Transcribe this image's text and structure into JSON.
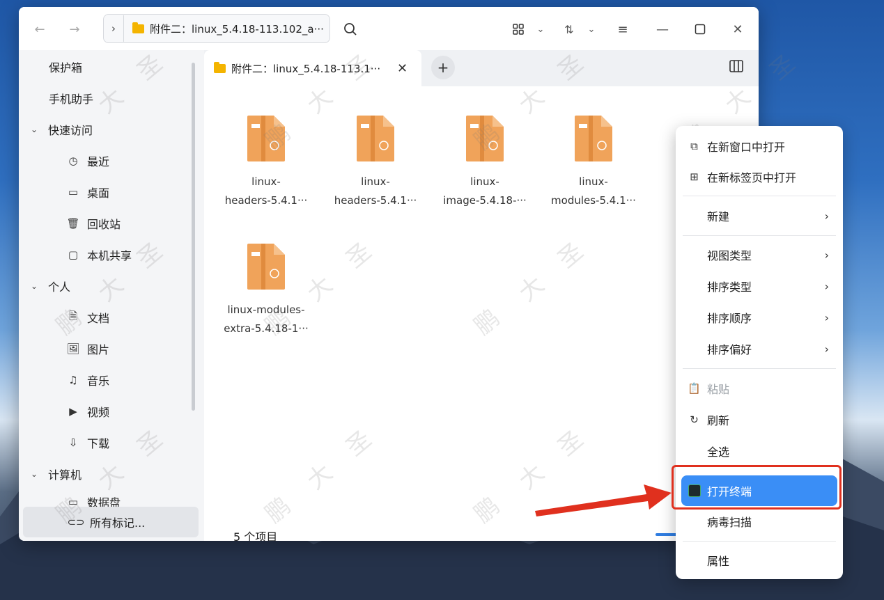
{
  "titlebar": {
    "address_text": "附件二：linux_5.4.18-113.102_a···",
    "back_icon": "arrow-left-icon",
    "forward_icon": "arrow-right-icon"
  },
  "sidebar": {
    "items": [
      {
        "label": "保护箱"
      },
      {
        "label": "手机助手"
      },
      {
        "label": "快速访问"
      },
      {
        "label": "最近"
      },
      {
        "label": "桌面"
      },
      {
        "label": "回收站"
      },
      {
        "label": "本机共享"
      },
      {
        "label": "个人"
      },
      {
        "label": "文档"
      },
      {
        "label": "图片"
      },
      {
        "label": "音乐"
      },
      {
        "label": "视频"
      },
      {
        "label": "下载"
      },
      {
        "label": "计算机"
      },
      {
        "label": "数据盘"
      }
    ],
    "tags_button": "所有标记..."
  },
  "tab": {
    "title": "附件二：linux_5.4.18-113.1···"
  },
  "files": [
    {
      "line1": "linux-",
      "line2": "headers-5.4.1···"
    },
    {
      "line1": "linux-",
      "line2": "headers-5.4.1···"
    },
    {
      "line1": "linux-",
      "line2": "image-5.4.18-···"
    },
    {
      "line1": "linux-",
      "line2": "modules-5.4.1···"
    },
    {
      "line1": "linux-modules-",
      "line2": "extra-5.4.18-1···"
    }
  ],
  "status": {
    "count_text": "5 个项目"
  },
  "context_menu": {
    "items": [
      {
        "label": "在新窗口中打开"
      },
      {
        "label": "在新标签页中打开"
      },
      {
        "label": "新建"
      },
      {
        "label": "视图类型"
      },
      {
        "label": "排序类型"
      },
      {
        "label": "排序顺序"
      },
      {
        "label": "排序偏好"
      },
      {
        "label": "粘贴"
      },
      {
        "label": "刷新"
      },
      {
        "label": "全选"
      },
      {
        "label": "打开终端"
      },
      {
        "label": "病毒扫描"
      },
      {
        "label": "属性"
      }
    ]
  },
  "watermark_chars": [
    "圣",
    "大",
    "鹏"
  ],
  "colors": {
    "highlight": "#3a8ef6",
    "annotation": "#e0301e",
    "folder": "#f4b400",
    "package": "#f0a35a"
  }
}
